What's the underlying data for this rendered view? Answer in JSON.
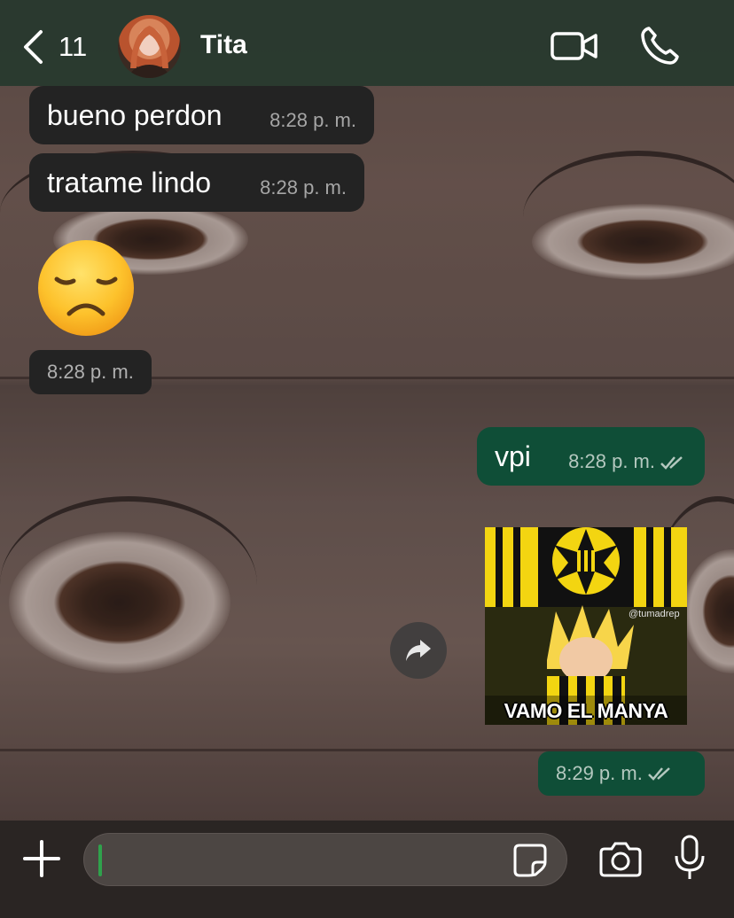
{
  "header": {
    "back_count": "11",
    "contact_name": "Tita",
    "icons": {
      "back": "chevron-left-icon",
      "video": "video-camera-icon",
      "call": "phone-icon"
    }
  },
  "messages": [
    {
      "direction": "in",
      "text": "bueno perdon",
      "time": "8:28 p. m."
    },
    {
      "direction": "in",
      "text": "tratame lindo",
      "time": "8:28 p. m."
    },
    {
      "direction": "in",
      "emoji": "😞",
      "time": "8:28 p. m."
    },
    {
      "direction": "out",
      "text": "vpi",
      "time": "8:28 p. m.",
      "status": "read"
    },
    {
      "direction": "out",
      "sticker_caption": "VAMO EL MANYA",
      "sticker_watermark": "@tumadrep",
      "time": "8:29 p. m.",
      "status": "read"
    }
  ],
  "composer": {
    "input_value": "",
    "icons": {
      "add": "plus-icon",
      "sticker": "sticker-icon",
      "camera": "camera-icon",
      "mic": "microphone-icon"
    }
  },
  "colors": {
    "header_bg": "#26382e",
    "incoming_bubble": "#232323",
    "outgoing_bubble": "#0f4e37",
    "caret": "#2fa24c",
    "read_ticks": "#b4c8bf"
  }
}
